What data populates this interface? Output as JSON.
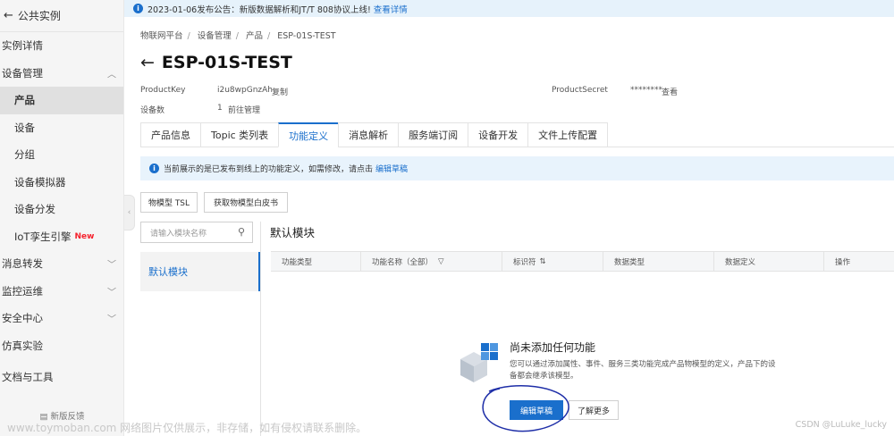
{
  "sidebar": {
    "back_label": "公共实例",
    "items": [
      {
        "label": "实例详情"
      },
      {
        "label": "设备管理"
      },
      {
        "label": "产品"
      },
      {
        "label": "设备"
      },
      {
        "label": "分组"
      },
      {
        "label": "设备模拟器"
      },
      {
        "label": "设备分发"
      },
      {
        "label": "IoT孪生引擎",
        "badge": "New"
      },
      {
        "label": "消息转发"
      },
      {
        "label": "监控运维"
      },
      {
        "label": "安全中心"
      },
      {
        "label": "仿真实验"
      },
      {
        "label": "文档与工具"
      }
    ],
    "feedback": "新版反馈"
  },
  "notice": {
    "text": "2023-01-06发布公告：新版数据解析和JT/T 808协议上线!",
    "link": "查看详情"
  },
  "breadcrumb": [
    "物联网平台",
    "设备管理",
    "产品",
    "ESP-01S-TEST"
  ],
  "page_title": "ESP-01S-TEST",
  "meta": {
    "product_key_label": "ProductKey",
    "product_key_value": "i2u8wpGnzAh",
    "copy_link": "复制",
    "product_secret_label": "ProductSecret",
    "product_secret_value": "********",
    "view_link": "查看",
    "device_count_label": "设备数",
    "device_count_value": "1",
    "manage_link": "前往管理"
  },
  "tabs": [
    "产品信息",
    "Topic 类列表",
    "功能定义",
    "消息解析",
    "服务端订阅",
    "设备开发",
    "文件上传配置"
  ],
  "info": {
    "text": "当前展示的是已发布到线上的功能定义，如需修改，请点击",
    "link": "编辑草稿"
  },
  "buttons": {
    "tsl": "物模型 TSL",
    "whitepaper": "获取物模型白皮书"
  },
  "search": {
    "placeholder": "请输入模块名称"
  },
  "module": {
    "title": "默认模块",
    "list_item": "默认模块"
  },
  "table": {
    "columns": [
      "功能类型",
      "功能名称（全部）",
      "标识符",
      "数据类型",
      "数据定义",
      "操作"
    ]
  },
  "empty": {
    "title": "尚未添加任何功能",
    "desc": "您可以通过添加属性、事件、服务三类功能完成产品物模型的定义，产品下的设备都会继承该模型。",
    "primary": "编辑草稿",
    "secondary": "了解更多"
  },
  "watermark": {
    "left": "www.toymoban.com 网络图片仅供展示，非存储，如有侵权请联系删除。",
    "right": "CSDN @LuLuke_lucky"
  },
  "colors": {
    "accent": "#1a6fcc",
    "sidebar_bg": "#f5f5f5",
    "notice_bg": "#e6f2fb"
  }
}
